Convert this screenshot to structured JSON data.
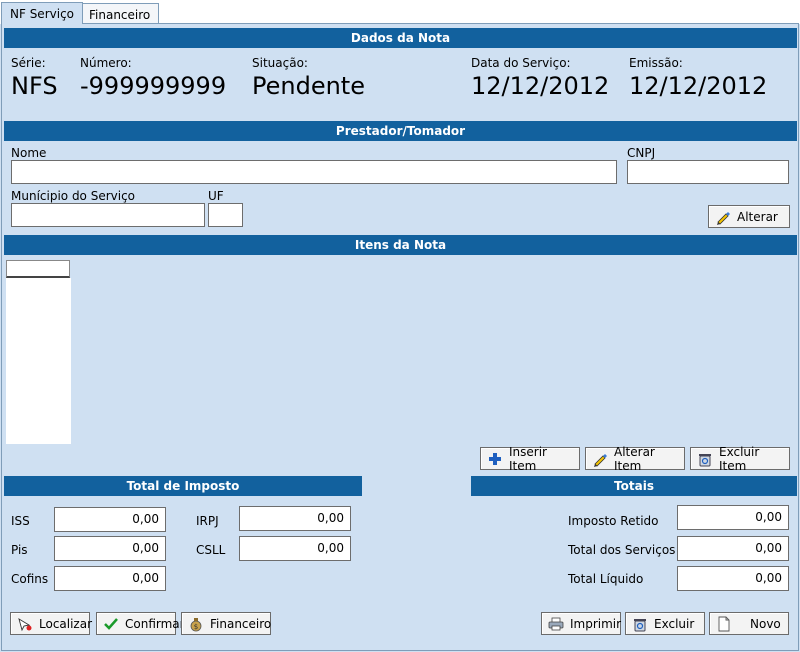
{
  "tabs": [
    {
      "label": "NF Serviço"
    },
    {
      "label": "Financeiro"
    }
  ],
  "dados_nota": {
    "header": "Dados da Nota",
    "serie_label": "Série:",
    "serie": "NFS",
    "numero_label": "Número:",
    "numero": "-999999999",
    "situacao_label": "Situação:",
    "situacao": "Pendente",
    "data_servico_label": "Data do Serviço:",
    "data_servico": "12/12/2012",
    "emissao_label": "Emissão:",
    "emissao": "12/12/2012"
  },
  "prestador": {
    "header": "Prestador/Tomador",
    "nome_label": "Nome",
    "nome_value": "",
    "cnpj_label": "CNPJ",
    "cnpj_value": "",
    "municipio_label": "Munícipio do Serviço",
    "municipio_value": "",
    "uf_label": "UF",
    "uf_value": "",
    "alterar_button": "Alterar"
  },
  "itens": {
    "header": "Itens da Nota",
    "inserir_button": "Inserir Item",
    "alterar_button": "Alterar Item",
    "excluir_button": "Excluir Item"
  },
  "imposto": {
    "header": "Total de Imposto",
    "iss_label": "ISS",
    "iss": "0,00",
    "pis_label": "Pis",
    "pis": "0,00",
    "cofins_label": "Cofins",
    "cofins": "0,00",
    "irpj_label": "IRPJ",
    "irpj": "0,00",
    "csll_label": "CSLL",
    "csll": "0,00"
  },
  "totais": {
    "header": "Totais",
    "imposto_retido_label": "Imposto Retido",
    "imposto_retido": "0,00",
    "total_servicos_label": "Total dos Serviços",
    "total_servicos": "0,00",
    "total_liquido_label": "Total Líquido",
    "total_liquido": "0,00"
  },
  "footer": {
    "localizar": "Localizar",
    "confirmar": "Confirmar",
    "financeiro": "Financeiro",
    "imprimir": "Imprimir",
    "excluir": "Excluir",
    "novo": "Novo"
  },
  "colors": {
    "header_bar": "#12619e",
    "panel_bg": "#cfe0f2"
  }
}
